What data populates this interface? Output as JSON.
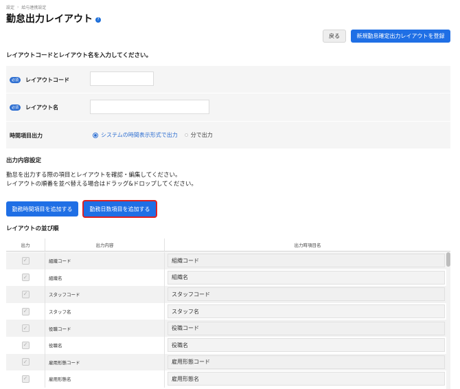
{
  "breadcrumb": [
    "設定",
    "給与連携設定"
  ],
  "breadcrumb_sep": "›",
  "title": "勤怠出力レイアウト",
  "help_glyph": "?",
  "header_buttons": {
    "back": "戻る",
    "new_layout": "新規勤怠確定出力レイアウトを登録"
  },
  "form": {
    "heading": "レイアウトコードとレイアウト名を入力してください。",
    "required_badge": "必須",
    "code_label": "レイアウトコード",
    "code_value": "",
    "name_label": "レイアウト名",
    "name_value": "",
    "time_output_label": "時間項目出力",
    "time_options": [
      "システムの時間表示形式で出力",
      "分で出力"
    ],
    "time_selected": "システムの時間表示形式で出力"
  },
  "output_settings": {
    "heading": "出力内容設定",
    "desc_line1": "勤怠を出力する際の項目とレイアウトを確認・編集してください。",
    "desc_line2": "レイアウトの順番を並べ替える場合はドラッグ&ドロップしてください。",
    "add_time_button": "勤務時間項目を追加する",
    "add_days_button": "勤務日数項目を追加する"
  },
  "layout_order": {
    "heading": "レイアウトの並び順",
    "columns": [
      "出力",
      "出力内容",
      "出力時項目名"
    ],
    "check_glyph": "✓",
    "rows": [
      {
        "content": "組織コード",
        "name": "組織コード",
        "checked": true
      },
      {
        "content": "組織名",
        "name": "組織名",
        "checked": true
      },
      {
        "content": "スタッフコード",
        "name": "スタッフコード",
        "checked": true
      },
      {
        "content": "スタッフ名",
        "name": "スタッフ名",
        "checked": true
      },
      {
        "content": "役職コード",
        "name": "役職コード",
        "checked": true
      },
      {
        "content": "役職名",
        "name": "役職名",
        "checked": true
      },
      {
        "content": "雇用形態コード",
        "name": "雇用形態コード",
        "checked": true
      },
      {
        "content": "雇用形態名",
        "name": "雇用形態名",
        "checked": true
      }
    ]
  },
  "colors": {
    "primary": "#1f6fe5",
    "highlight_outline": "#e02020",
    "badge": "#2e6fd1"
  }
}
